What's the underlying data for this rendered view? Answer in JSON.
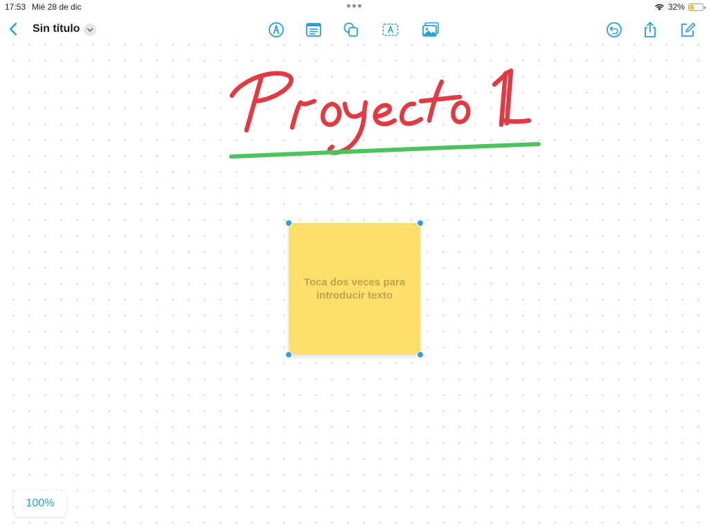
{
  "status_bar": {
    "time": "17:53",
    "date": "Mié 28 de dic",
    "battery_percent": "32%",
    "battery_level": 0.32
  },
  "toolbar": {
    "title": "Sin título",
    "tools": [
      {
        "name": "pen-tool-icon"
      },
      {
        "name": "note-tool-icon"
      },
      {
        "name": "shapes-tool-icon"
      },
      {
        "name": "text-box-tool-icon"
      },
      {
        "name": "media-tool-icon"
      }
    ],
    "right_tools": [
      {
        "name": "undo-icon"
      },
      {
        "name": "share-icon"
      },
      {
        "name": "new-board-icon"
      }
    ]
  },
  "canvas": {
    "handwriting": "Proyecto 1",
    "handwriting_color": "#e03a45",
    "underline_color": "#4cc35d",
    "sticky_note": {
      "placeholder": "Toca dos veces para introducir texto",
      "color": "#fedf6a"
    }
  },
  "zoom": {
    "level": "100%"
  },
  "colors": {
    "accent": "#2a9fd6"
  }
}
